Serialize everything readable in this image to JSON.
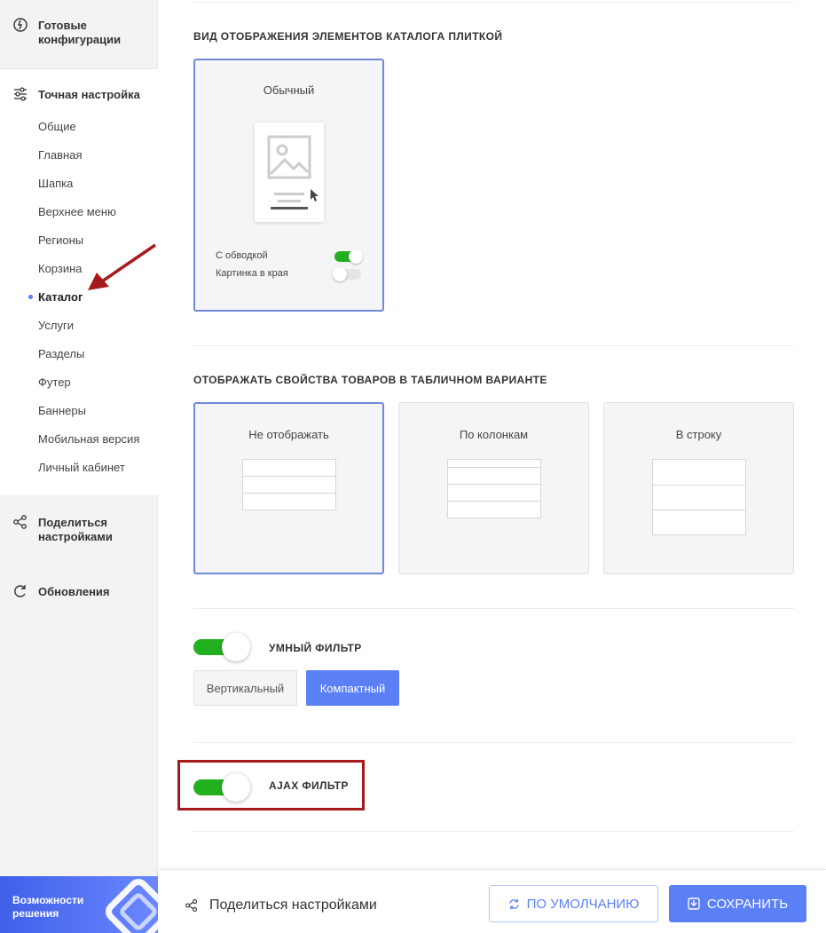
{
  "sidebar": {
    "ready_configs": "Готовые конфигурации",
    "fine_tuning": "Точная настройка",
    "items": [
      "Общие",
      "Главная",
      "Шапка",
      "Верхнее меню",
      "Регионы",
      "Корзина",
      "Каталог",
      "Услуги",
      "Разделы",
      "Футер",
      "Баннеры",
      "Мобильная версия",
      "Личный кабинет"
    ],
    "active_item": "Каталог",
    "share": "Поделиться настройками",
    "updates": "Обновления",
    "promo": "Возможности решения"
  },
  "tile_section": {
    "title": "ВИД ОТОБРАЖЕНИЯ ЭЛЕМЕНТОВ КАТАЛОГА ПЛИТКОЙ",
    "card_label": "Обычный",
    "opt_border": "С обводкой",
    "opt_border_on": true,
    "opt_edge": "Картинка в края",
    "opt_edge_on": false
  },
  "table_section": {
    "title": "ОТОБРАЖАТЬ СВОЙСТВА ТОВАРОВ В ТАБЛИЧНОМ ВАРИАНТЕ",
    "options": [
      "Не отображать",
      "По колонкам",
      "В строку"
    ],
    "selected": "Не отображать"
  },
  "smart_filter": {
    "label": "УМНЫЙ ФИЛЬТР",
    "on": true,
    "modes": [
      "Вертикальный",
      "Компактный"
    ],
    "selected": "Компактный"
  },
  "ajax_filter": {
    "label": "AJAX ФИЛЬТР",
    "on": true
  },
  "footer": {
    "share": "Поделиться настройками",
    "default_btn": "ПО УМОЛЧАНИЮ",
    "save_btn": "СОХРАНИТЬ"
  },
  "colors": {
    "accent": "#5b7ff5",
    "toggle_on": "#22b021",
    "highlight": "#a51b1b"
  }
}
